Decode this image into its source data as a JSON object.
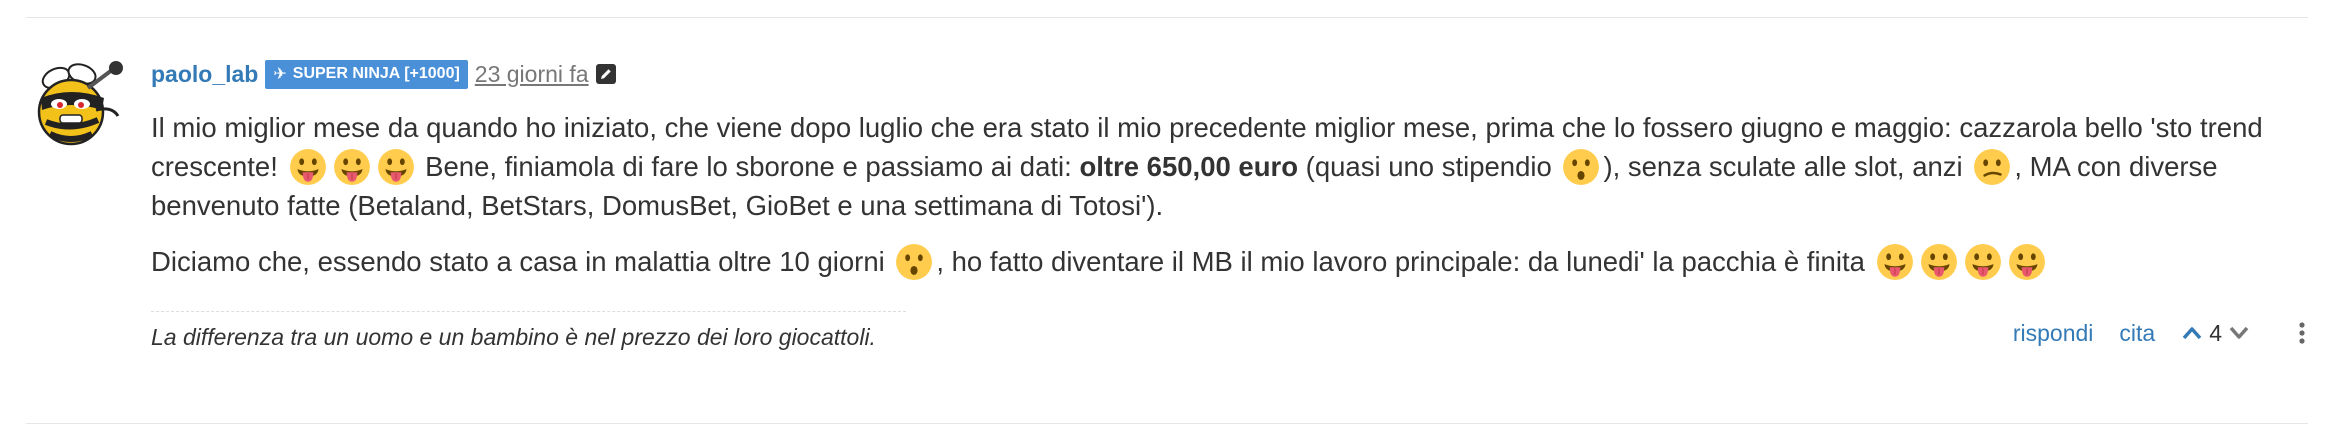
{
  "post": {
    "author": {
      "username": "paolo_lab",
      "badge": "SUPER NINJA [+1000]"
    },
    "timestamp": "23 giorni fa",
    "body": {
      "p1_part1": "Il mio miglior mese da quando ho iniziato, che viene dopo luglio che era stato il mio precedente miglior mese, prima che lo fossero giugno e maggio: cazzarola bello 'sto trend crescente!",
      "p1_part2": "Bene, finiamola di fare lo sborone e passiamo ai dati:",
      "p1_bold": "oltre 650,00 euro",
      "p1_part3": "(quasi uno stipendio",
      "p1_part4": "), senza sculate alle slot, anzi",
      "p1_part5": ", MA con diverse benvenuto fatte (Betaland, BetStars, DomusBet, GioBet e una settimana di Totosi').",
      "p2_part1": "Diciamo che, essendo stato a casa in malattia oltre 10 giorni",
      "p2_part2": ", ho fatto diventare il MB il mio lavoro principale: da lunedi' la pacchia è finita"
    },
    "signature": "La differenza tra un uomo e un bambino è nel prezzo dei loro giocattoli.",
    "actions": {
      "reply": "rispondi",
      "quote": "cita",
      "votes": "4"
    },
    "icons": {
      "badge": "airplane-icon",
      "edit": "pencil-icon",
      "avatar": "bee-ninja-avatar",
      "upvote": "chevron-up-icon",
      "downvote": "chevron-down-icon",
      "menu": "vertical-ellipsis-icon",
      "emoji_tongue": "tongue-out-emoji",
      "emoji_surprised": "surprised-emoji",
      "emoji_confused": "confused-emoji"
    },
    "colors": {
      "link": "#337ab7",
      "badge_bg": "#4a90d9",
      "emoji_face": "#ffcc4d"
    }
  }
}
